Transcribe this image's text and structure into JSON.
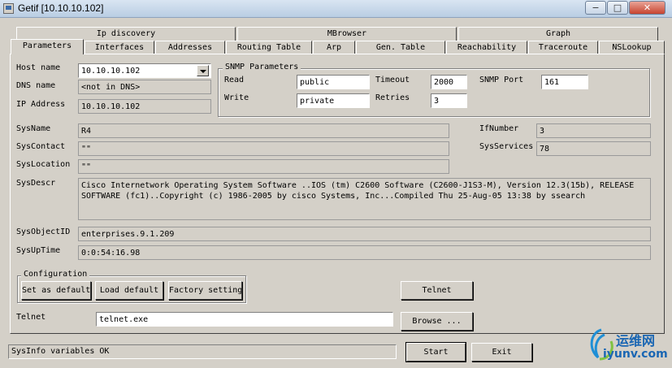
{
  "window": {
    "title": "Getif [10.10.10.102]",
    "minimize": "−",
    "maximize": "□",
    "close": "✕"
  },
  "tabs_row1": [
    "Ip discovery",
    "MBrowser",
    "Graph"
  ],
  "tabs_row2": [
    "Parameters",
    "Interfaces",
    "Addresses",
    "Routing Table",
    "Arp",
    "Gen. Table",
    "Reachability",
    "Traceroute",
    "NSLookup"
  ],
  "host": {
    "host_name_label": "Host name",
    "host_name_value": "10.10.10.102",
    "dns_label": "DNS name",
    "dns_value": "<not in DNS>",
    "ip_label": "IP Address",
    "ip_value": "10.10.10.102"
  },
  "snmp": {
    "group_label": "SNMP Parameters",
    "read_label": "Read",
    "read_value": "public",
    "write_label": "Write",
    "write_value": "private",
    "timeout_label": "Timeout",
    "timeout_value": "2000",
    "retries_label": "Retries",
    "retries_value": "3",
    "port_label": "SNMP Port",
    "port_value": "161"
  },
  "system": {
    "sysname_label": "SysName",
    "sysname_value": "R4",
    "syscontact_label": "SysContact",
    "syscontact_value": "\"\"",
    "syslocation_label": "SysLocation",
    "syslocation_value": "\"\"",
    "sysdescr_label": "SysDescr",
    "sysdescr_line1": "Cisco Internetwork Operating System Software ..IOS (tm) C2600 Software (C2600-J1S3-M), Version 12.3(15b), RELEASE",
    "sysdescr_line2": "SOFTWARE (fc1)..Copyright (c) 1986-2005 by cisco Systems, Inc...Compiled Thu 25-Aug-05 13:38 by ssearch",
    "ifnumber_label": "IfNumber",
    "ifnumber_value": "3",
    "sysservices_label": "SysServices",
    "sysservices_value": "78",
    "sysobjectid_label": "SysObjectID",
    "sysobjectid_value": "enterprises.9.1.209",
    "sysuptime_label": "SysUpTime",
    "sysuptime_value": "0:0:54:16.98"
  },
  "configuration": {
    "group_label": "Configuration",
    "set_default": "Set as default",
    "load_default": "Load default",
    "factory_setting": "Factory setting"
  },
  "telnet": {
    "label": "Telnet",
    "path_value": "telnet.exe",
    "telnet_button": "Telnet",
    "browse_button": "Browse ..."
  },
  "bottom": {
    "status": "SysInfo variables OK",
    "start": "Start",
    "exit": "Exit"
  },
  "watermark": {
    "cn": "运维网",
    "url": "iyunv.com"
  }
}
